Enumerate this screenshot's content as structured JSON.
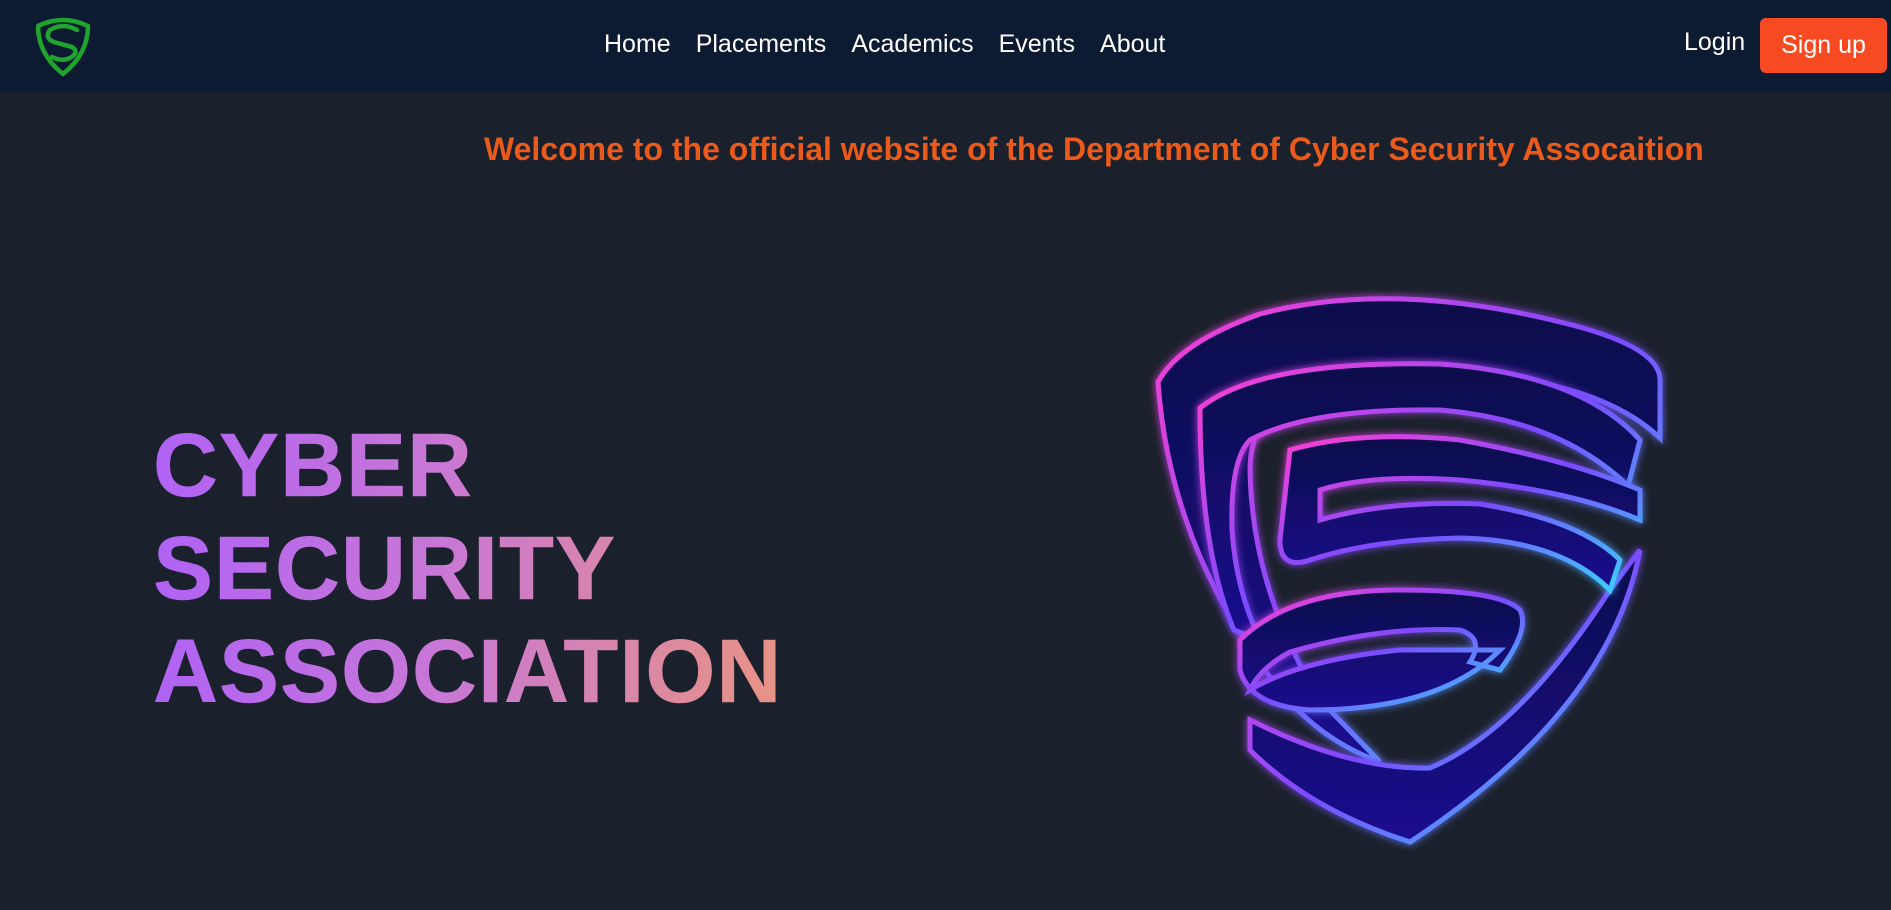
{
  "header": {
    "logo_icon": "shield-s-logo-icon",
    "nav": [
      {
        "label": "Home"
      },
      {
        "label": "Placements"
      },
      {
        "label": "Academics"
      },
      {
        "label": "Events"
      },
      {
        "label": "About"
      }
    ],
    "login_label": "Login",
    "signup_label": "Sign up"
  },
  "welcome_text": "Welcome to the official website of the Department of Cyber Security Assocaition",
  "hero": {
    "title_lines": [
      "CYBER",
      "SECURITY",
      "ASSOCIATION"
    ],
    "image_icon": "neon-shield-s-icon"
  },
  "colors": {
    "navbar_bg": "#0c1b31",
    "page_bg": "#1b212c",
    "accent_orange": "#ea5a1a",
    "signup_button": "#f84a22",
    "logo_green": "#1fa52e",
    "title_gradient_start": "#b062f5",
    "title_gradient_end": "#e89384"
  }
}
